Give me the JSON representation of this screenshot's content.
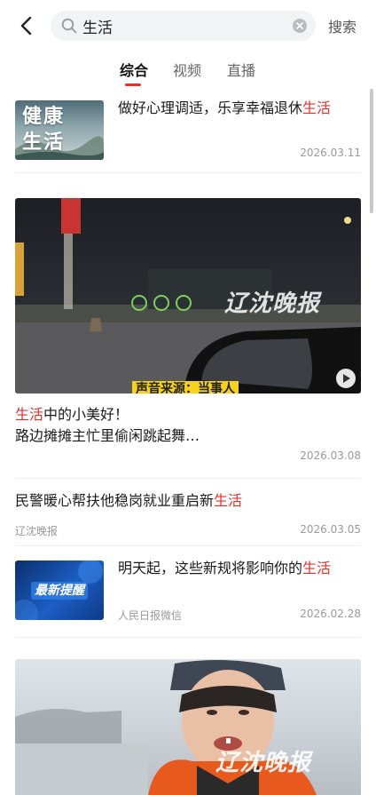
{
  "search": {
    "query": "生活",
    "button_label": "搜索"
  },
  "tabs": [
    {
      "label": "综合",
      "active": true
    },
    {
      "label": "视频",
      "active": false
    },
    {
      "label": "直播",
      "active": false
    }
  ],
  "colors": {
    "accent": "#e8302b"
  },
  "results": [
    {
      "title_pre": "做好心理调适，乐享幸福退休",
      "title_hl": "生活",
      "thumb_text": "健康生活",
      "date": "2026.03.11"
    },
    {
      "title_hl": "生活",
      "title_line1": "中的小美好！",
      "title_line2": "路边摊摊主忙里偷闲跳起舞…",
      "watermark": "辽沈晚报",
      "caption": "声音来源：当事人",
      "date": "2026.03.08"
    },
    {
      "title_pre": "民警暖心帮扶他稳岗就业重启新",
      "title_hl": "生活",
      "source": "辽沈晚报",
      "date": "2026.03.05"
    },
    {
      "title_pre": "明天起，这些新规将影响你的",
      "title_hl": "生活",
      "thumb_text": "最新提醒",
      "source": "人民日报微信",
      "date": "2026.02.28"
    },
    {
      "watermark": "辽沈晚报"
    }
  ]
}
